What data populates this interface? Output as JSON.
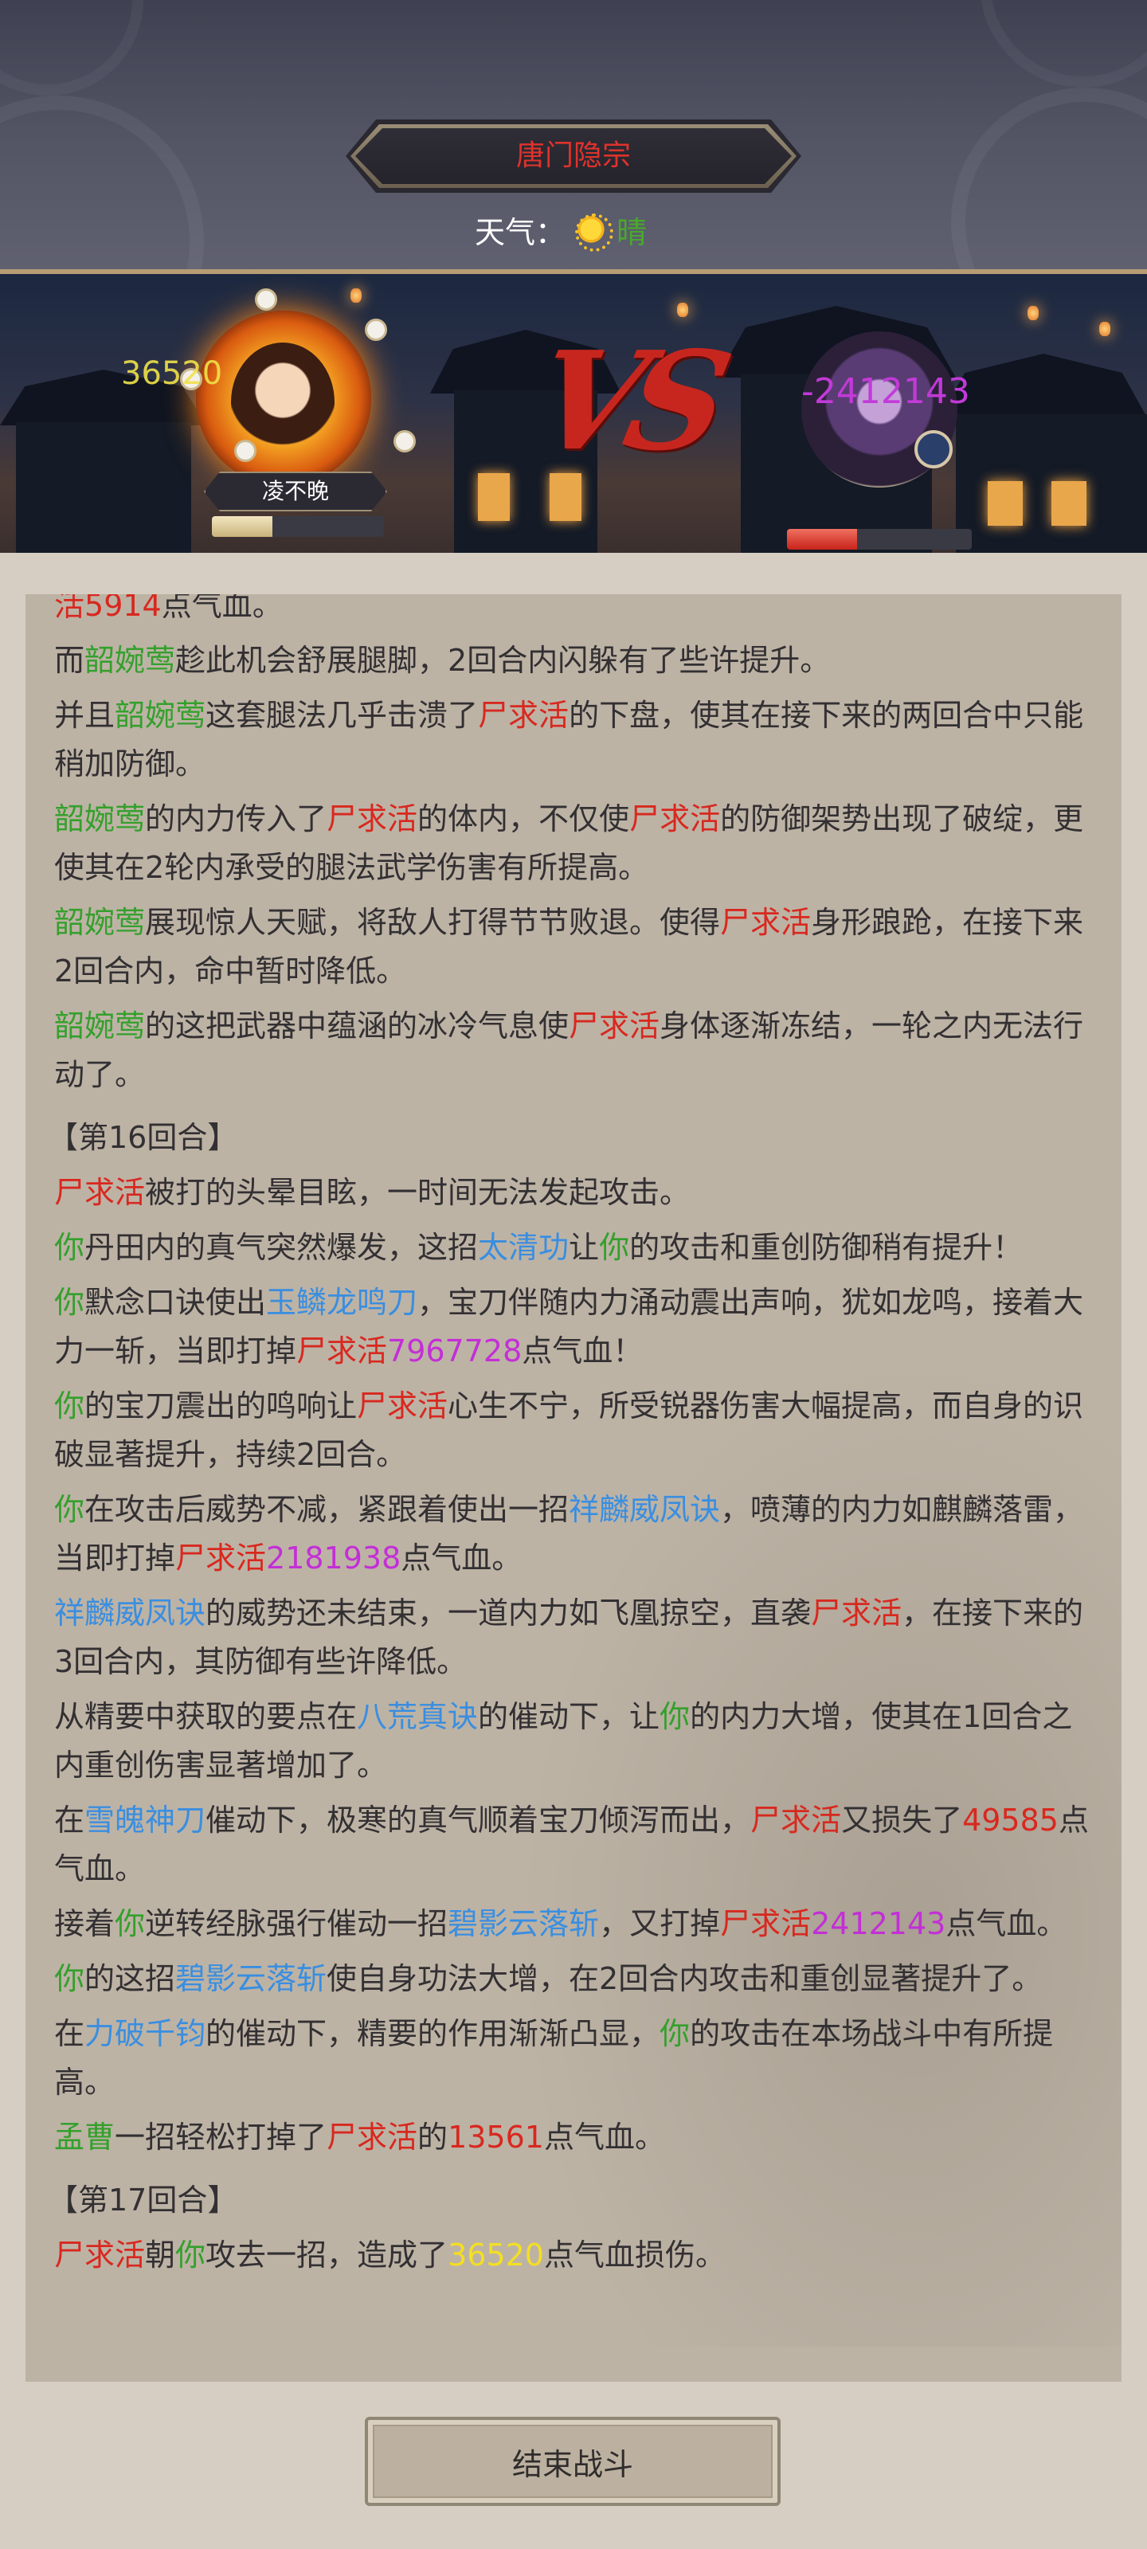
{
  "header": {
    "location_title": "唐门隐宗",
    "weather_label": "天气：",
    "weather_value": "晴"
  },
  "battle": {
    "player_name": "凌不晚",
    "player_damage_popup": "36520",
    "enemy_damage_popup": "-2412143",
    "vs_text": "VS",
    "player_hp_fraction": 0.35,
    "enemy_hp_fraction": 0.38
  },
  "colors": {
    "ally": "#34a02c",
    "enemy": "#d8281f",
    "skill": "#3a8ee0",
    "big_damage": "#c32fd6",
    "enemy_damage": "#f4df22",
    "title": "#e0322c"
  },
  "log": [
    {
      "segments": [
        {
          "t": "活",
          "c": "enemy"
        },
        {
          "t": "5914",
          "c": "enemy"
        },
        {
          "t": "点气血。"
        }
      ]
    },
    {
      "segments": [
        {
          "t": "而"
        },
        {
          "t": "韶婉莺",
          "c": "ally"
        },
        {
          "t": "趁此机会舒展腿脚，2回合内闪躲有了些许提升。"
        }
      ]
    },
    {
      "segments": [
        {
          "t": "并且"
        },
        {
          "t": "韶婉莺",
          "c": "ally"
        },
        {
          "t": "这套腿法几乎击溃了"
        },
        {
          "t": "尸求活",
          "c": "enemy"
        },
        {
          "t": "的下盘，使其在接下来的两回合中只能稍加防御。"
        }
      ]
    },
    {
      "segments": [
        {
          "t": "韶婉莺",
          "c": "ally"
        },
        {
          "t": "的内力传入了"
        },
        {
          "t": "尸求活",
          "c": "enemy"
        },
        {
          "t": "的体内，不仅使"
        },
        {
          "t": "尸求活",
          "c": "enemy"
        },
        {
          "t": "的防御架势出现了破绽，更使其在2轮内承受的腿法武学伤害有所提高。"
        }
      ]
    },
    {
      "segments": [
        {
          "t": "韶婉莺",
          "c": "ally"
        },
        {
          "t": "展现惊人天赋，将敌人打得节节败退。使得"
        },
        {
          "t": "尸求活",
          "c": "enemy"
        },
        {
          "t": "身形踉跄，在接下来2回合内，命中暂时降低。"
        }
      ]
    },
    {
      "segments": [
        {
          "t": "韶婉莺",
          "c": "ally"
        },
        {
          "t": "的这把武器中蕴涵的冰冷气息使"
        },
        {
          "t": "尸求活",
          "c": "enemy"
        },
        {
          "t": "身体逐渐冻结，一轮之内无法行动了。"
        }
      ]
    },
    {
      "round": "【第16回合】"
    },
    {
      "segments": [
        {
          "t": "尸求活",
          "c": "enemy"
        },
        {
          "t": "被打的头晕目眩，一时间无法发起攻击。"
        }
      ]
    },
    {
      "segments": [
        {
          "t": "你",
          "c": "ally"
        },
        {
          "t": "丹田内的真气突然爆发，这招"
        },
        {
          "t": "太清功",
          "c": "skill"
        },
        {
          "t": "让"
        },
        {
          "t": "你",
          "c": "ally"
        },
        {
          "t": "的攻击和重创防御稍有提升！"
        }
      ]
    },
    {
      "segments": [
        {
          "t": "你",
          "c": "ally"
        },
        {
          "t": "默念口诀使出"
        },
        {
          "t": "玉鳞龙鸣刀",
          "c": "skill"
        },
        {
          "t": "，宝刀伴随内力涌动震出声响，犹如龙鸣，接着大力一斩，当即打掉"
        },
        {
          "t": "尸求活",
          "c": "enemy"
        },
        {
          "t": "7967728",
          "c": "big_damage"
        },
        {
          "t": "点气血！"
        }
      ]
    },
    {
      "segments": [
        {
          "t": "你",
          "c": "ally"
        },
        {
          "t": "的宝刀震出的鸣响让"
        },
        {
          "t": "尸求活",
          "c": "enemy"
        },
        {
          "t": "心生不宁，所受锐器伤害大幅提高，而自身的识破显著提升，持续2回合。"
        }
      ]
    },
    {
      "segments": [
        {
          "t": "你",
          "c": "ally"
        },
        {
          "t": "在攻击后威势不减，紧跟着使出一招"
        },
        {
          "t": "祥麟威凤诀",
          "c": "skill"
        },
        {
          "t": "，喷薄的内力如麒麟落雷，当即打掉"
        },
        {
          "t": "尸求活",
          "c": "enemy"
        },
        {
          "t": "2181938",
          "c": "big_damage"
        },
        {
          "t": "点气血。"
        }
      ]
    },
    {
      "segments": [
        {
          "t": "祥麟威凤诀",
          "c": "skill"
        },
        {
          "t": "的威势还未结束，一道内力如飞凰掠空，直袭"
        },
        {
          "t": "尸求活",
          "c": "enemy"
        },
        {
          "t": "，在接下来的3回合内，其防御有些许降低。"
        }
      ]
    },
    {
      "segments": [
        {
          "t": "从精要中获取的要点在"
        },
        {
          "t": "八荒真诀",
          "c": "skill"
        },
        {
          "t": "的催动下，让"
        },
        {
          "t": "你",
          "c": "ally"
        },
        {
          "t": "的内力大增，使其在1回合之内重创伤害显著增加了。"
        }
      ]
    },
    {
      "segments": [
        {
          "t": "在"
        },
        {
          "t": "雪魄神刀",
          "c": "skill"
        },
        {
          "t": "催动下，极寒的真气顺着宝刀倾泻而出，"
        },
        {
          "t": "尸求活",
          "c": "enemy"
        },
        {
          "t": "又损失了"
        },
        {
          "t": "49585",
          "c": "enemy"
        },
        {
          "t": "点气血。"
        }
      ]
    },
    {
      "segments": [
        {
          "t": "接着"
        },
        {
          "t": "你",
          "c": "ally"
        },
        {
          "t": "逆转经脉强行催动一招"
        },
        {
          "t": "碧影云落斩",
          "c": "skill"
        },
        {
          "t": "，又打掉"
        },
        {
          "t": "尸求活",
          "c": "enemy"
        },
        {
          "t": "2412143",
          "c": "big_damage"
        },
        {
          "t": "点气血。"
        }
      ]
    },
    {
      "segments": [
        {
          "t": "你",
          "c": "ally"
        },
        {
          "t": "的这招"
        },
        {
          "t": "碧影云落斩",
          "c": "skill"
        },
        {
          "t": "使自身功法大增，在2回合内攻击和重创显著提升了。"
        }
      ]
    },
    {
      "segments": [
        {
          "t": "在"
        },
        {
          "t": "力破千钧",
          "c": "skill"
        },
        {
          "t": "的催动下，精要的作用渐渐凸显，"
        },
        {
          "t": "你",
          "c": "ally"
        },
        {
          "t": "的攻击在本场战斗中有所提高。"
        }
      ]
    },
    {
      "segments": [
        {
          "t": "孟曹",
          "c": "ally"
        },
        {
          "t": "一招轻松打掉了"
        },
        {
          "t": "尸求活",
          "c": "enemy"
        },
        {
          "t": "的"
        },
        {
          "t": "13561",
          "c": "enemy"
        },
        {
          "t": "点气血。"
        }
      ]
    },
    {
      "round": "【第17回合】"
    },
    {
      "segments": [
        {
          "t": "尸求活",
          "c": "enemy"
        },
        {
          "t": "朝"
        },
        {
          "t": "你",
          "c": "ally"
        },
        {
          "t": "攻去一招，造成了"
        },
        {
          "t": "36520",
          "c": "enemy_damage"
        },
        {
          "t": "点气血损伤。"
        }
      ]
    }
  ],
  "footer": {
    "end_battle_label": "结束战斗"
  }
}
